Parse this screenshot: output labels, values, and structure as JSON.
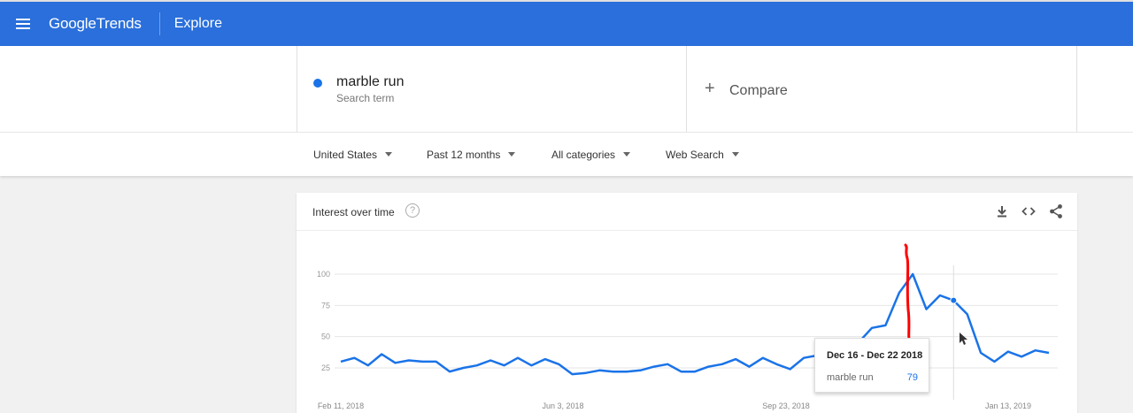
{
  "header": {
    "logo_google": "Google",
    "logo_trends": "Trends",
    "section": "Explore",
    "color": "#2a6fdb"
  },
  "term": {
    "name": "marble run",
    "subtitle": "Search term",
    "color": "#1a73e8"
  },
  "compare": {
    "label": "Compare"
  },
  "filters": {
    "region": "United States",
    "time": "Past 12 months",
    "category": "All categories",
    "search_type": "Web Search"
  },
  "card": {
    "title": "Interest over time",
    "help_icon": "?",
    "tools": [
      "download-icon",
      "embed-icon",
      "share-icon"
    ]
  },
  "chart_data": {
    "type": "line",
    "ylim": [
      0,
      100
    ],
    "y_ticks": [
      25,
      50,
      75,
      100
    ],
    "x_tick_labels": [
      "Feb 11, 2018",
      "Jun 3, 2018",
      "Sep 23, 2018",
      "Jan 13, 2019"
    ],
    "series": [
      {
        "name": "marble run",
        "color": "#1a73e8",
        "values": [
          30,
          33,
          27,
          36,
          29,
          31,
          30,
          30,
          22,
          25,
          27,
          31,
          27,
          33,
          27,
          32,
          28,
          20,
          21,
          23,
          22,
          22,
          23,
          26,
          28,
          22,
          22,
          26,
          28,
          32,
          26,
          33,
          28,
          24,
          33,
          35,
          40,
          43,
          45,
          57,
          59,
          85,
          100,
          72,
          83,
          79,
          68,
          37,
          30,
          38,
          34,
          39,
          37
        ]
      }
    ],
    "grid": true,
    "annotation": "red hand-drawn line marking the peak week"
  },
  "tooltip": {
    "date": "Dec 16 - Dec 22 2018",
    "term": "marble run",
    "value": "79"
  }
}
